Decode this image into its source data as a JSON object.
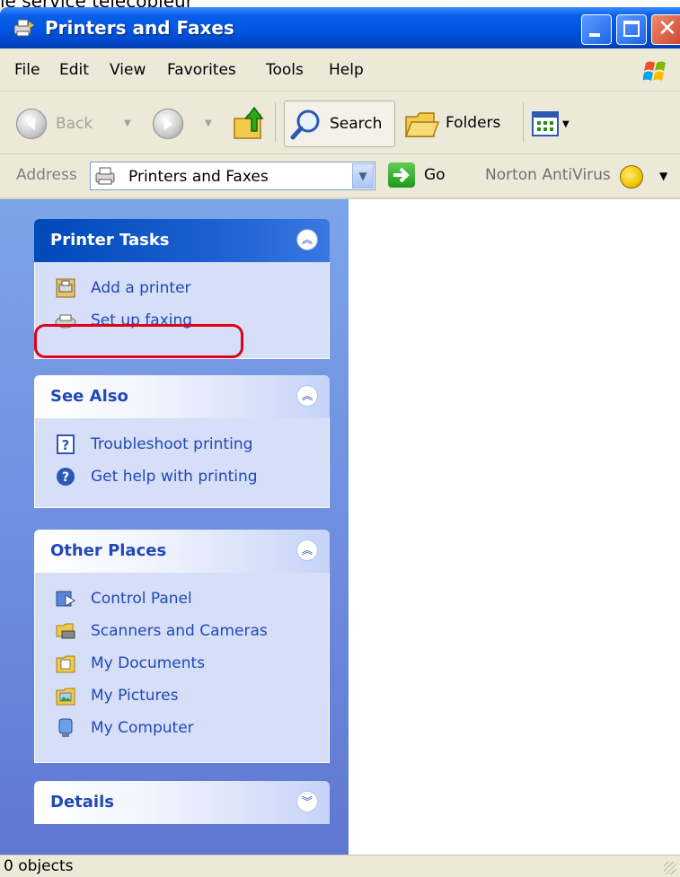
{
  "caption": "le service télécopieur",
  "window": {
    "title": "Printers and Faxes",
    "buttons": {
      "minimize": "minimize",
      "maximize": "maximize",
      "close": "close"
    }
  },
  "menu": [
    "File",
    "Edit",
    "View",
    "Favorites",
    "Tools",
    "Help"
  ],
  "toolbar": {
    "back": "Back",
    "search": "Search",
    "folders": "Folders"
  },
  "address": {
    "label": "Address",
    "value": "Printers and Faxes",
    "go": "Go",
    "norton": "Norton AntiVirus"
  },
  "panels": {
    "printer_tasks": {
      "title": "Printer Tasks",
      "items": [
        "Add a printer",
        "Set up faxing"
      ]
    },
    "see_also": {
      "title": "See Also",
      "items": [
        "Troubleshoot printing",
        "Get help with printing"
      ]
    },
    "other_places": {
      "title": "Other Places",
      "items": [
        "Control Panel",
        "Scanners and Cameras",
        "My Documents",
        "My Pictures",
        "My Computer"
      ]
    },
    "details": {
      "title": "Details"
    }
  },
  "status": {
    "text": "0 objects"
  },
  "colors": {
    "titlebar": "#0054e3",
    "highlight": "#e0001b",
    "link": "#2048b8"
  }
}
